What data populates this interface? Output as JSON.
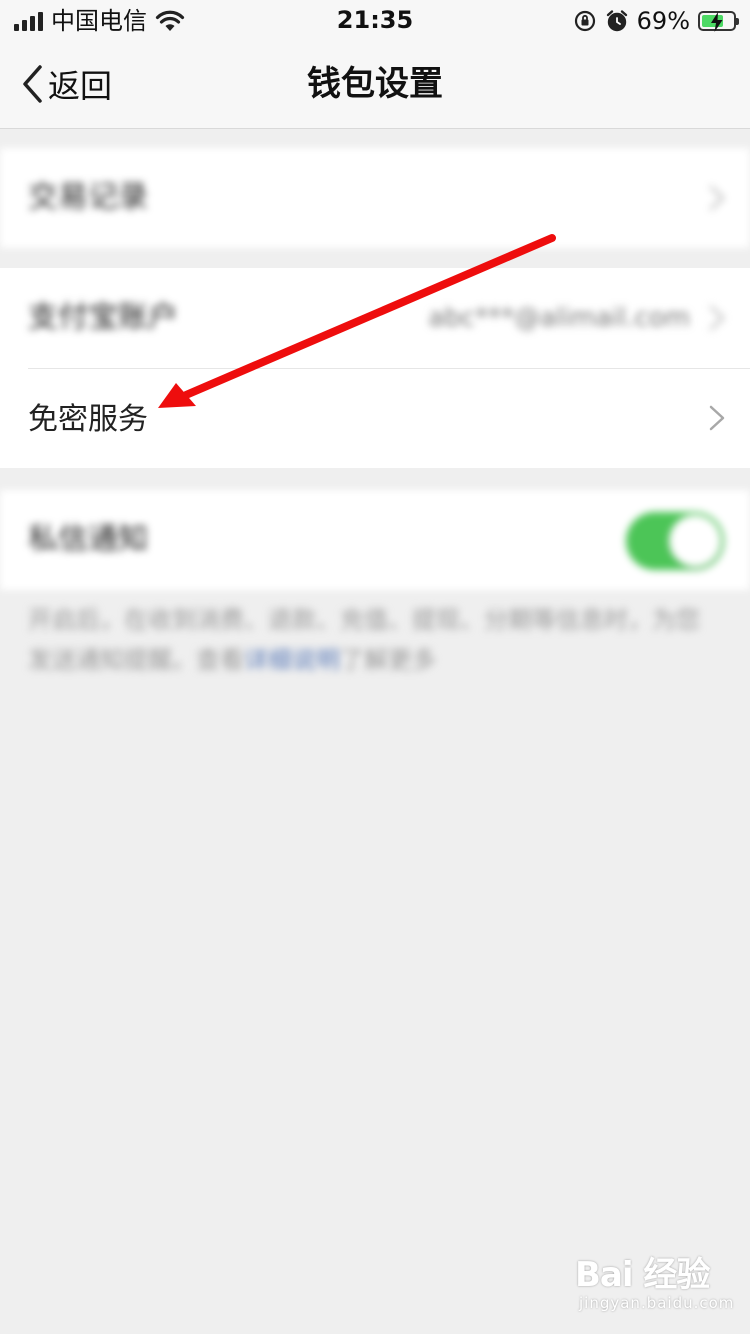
{
  "status_bar": {
    "carrier": "中国电信",
    "time": "21:35",
    "battery_percent": "69%",
    "battery_level": 0.69,
    "icons": [
      "signal-icon",
      "wifi-icon",
      "orientation-lock-icon",
      "alarm-icon",
      "battery-charging-icon"
    ]
  },
  "nav": {
    "back_label": "返回",
    "title": "钱包设置"
  },
  "list": {
    "row1_label": "交易记录",
    "row2_label": "支付宝账户",
    "row2_value": "abc***@alimail.com",
    "row3_label": "免密服务",
    "row4_label": "私信通知",
    "row4_toggle_on": true
  },
  "note": {
    "text_before": "开启后，在收到消费、退款、充值、提现、分期等信息时，为您发送通知提醒。查看",
    "link": "详细说明",
    "text_after": "了解更多"
  },
  "colors": {
    "annotation_arrow": "#ee0d0d",
    "toggle_on": "#4cc557",
    "background": "#efefef"
  },
  "watermark": {
    "logo": "Bai 经验",
    "sub": "jingyan.baidu.com"
  }
}
